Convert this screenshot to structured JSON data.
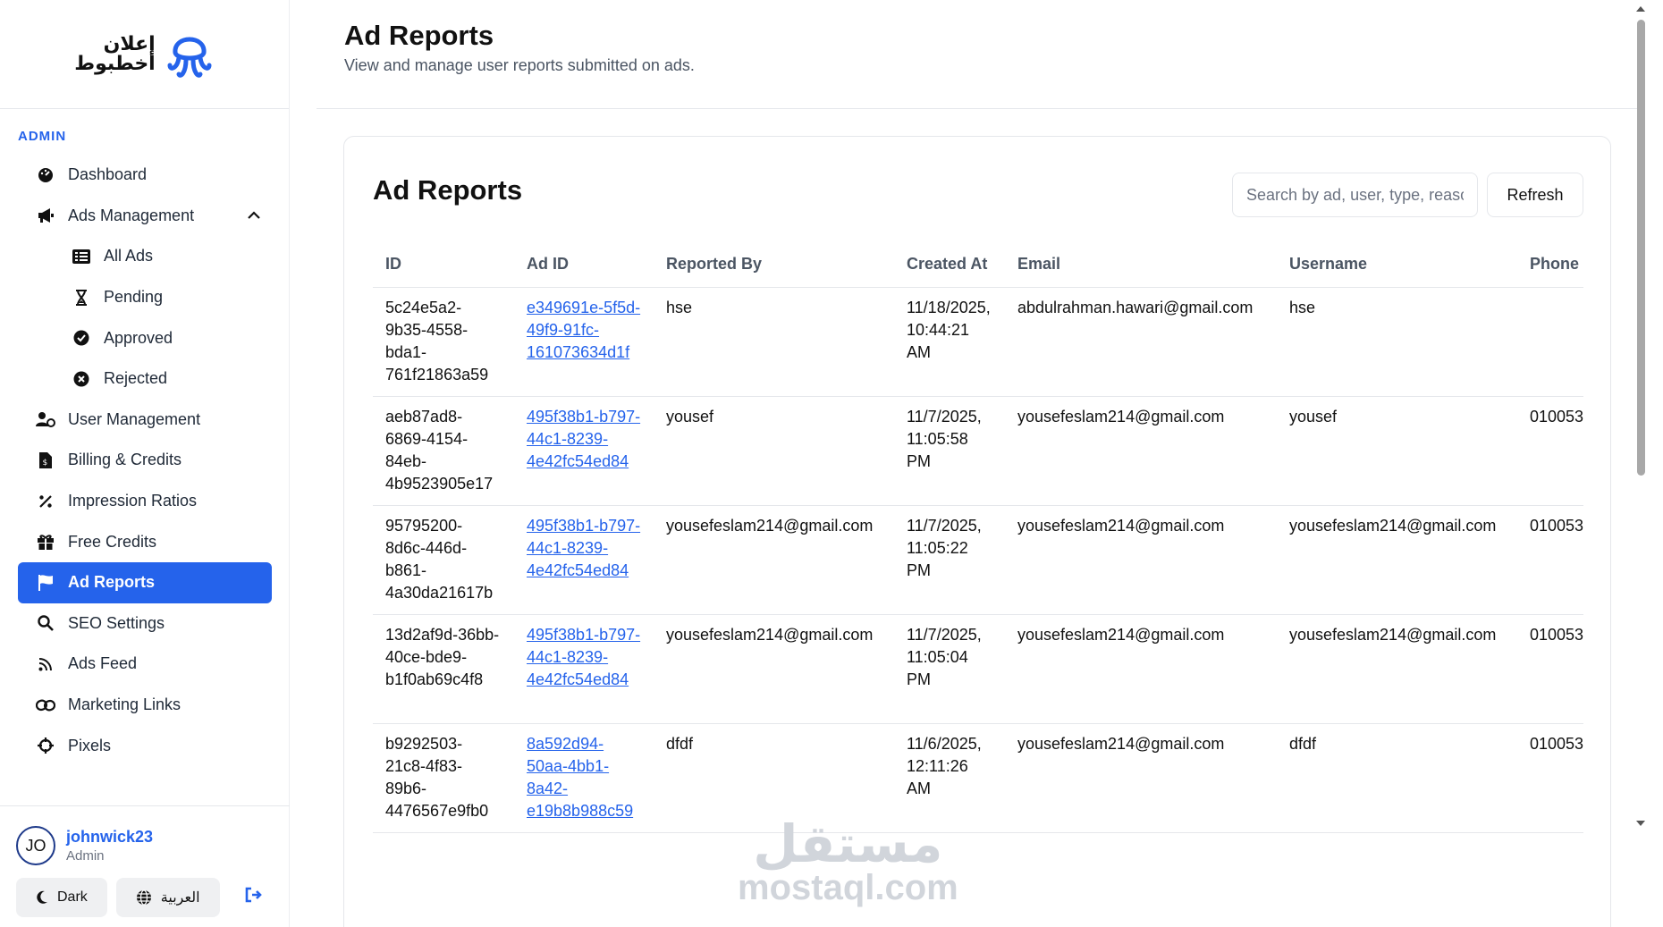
{
  "brand": {
    "logo_text_line1": "إعلان",
    "logo_text_line2": "أخطبوط"
  },
  "sidebar": {
    "section_label": "ADMIN",
    "items": [
      {
        "label": "Dashboard",
        "icon": "dashboard-gauge-icon"
      },
      {
        "label": "Ads Management",
        "icon": "megaphone-icon",
        "expanded": true
      },
      {
        "label": "All Ads",
        "icon": "list-icon",
        "sub": true
      },
      {
        "label": "Pending",
        "icon": "hourglass-icon",
        "sub": true
      },
      {
        "label": "Approved",
        "icon": "check-circle-icon",
        "sub": true
      },
      {
        "label": "Rejected",
        "icon": "x-circle-icon",
        "sub": true
      },
      {
        "label": "User Management",
        "icon": "user-cog-icon"
      },
      {
        "label": "Billing & Credits",
        "icon": "invoice-dollar-icon"
      },
      {
        "label": "Impression Ratios",
        "icon": "percent-icon"
      },
      {
        "label": "Free Credits",
        "icon": "gift-icon"
      },
      {
        "label": "Ad Reports",
        "icon": "flag-icon",
        "active": true
      },
      {
        "label": "SEO Settings",
        "icon": "search-icon"
      },
      {
        "label": "Ads Feed",
        "icon": "rss-icon"
      },
      {
        "label": "Marketing Links",
        "icon": "link-icon"
      },
      {
        "label": "Pixels",
        "icon": "crosshair-icon"
      }
    ]
  },
  "user": {
    "initials": "JO",
    "name": "johnwick23",
    "role": "Admin"
  },
  "footer_buttons": {
    "dark_label": "Dark",
    "lang_label": "العربية"
  },
  "header": {
    "title": "Ad Reports",
    "subtitle": "View and manage user reports submitted on ads."
  },
  "card": {
    "title": "Ad Reports",
    "search_placeholder": "Search by ad, user, type, reason...",
    "refresh_label": "Refresh"
  },
  "table": {
    "columns": [
      "ID",
      "Ad ID",
      "Reported By",
      "Created At",
      "Email",
      "Username",
      "Phone"
    ],
    "rows": [
      {
        "id": "5c24e5a2-9b35-4558-bda1-761f21863a59",
        "ad_id": "e349691e-5f5d-49f9-91fc-161073634d1f",
        "reported_by": "hse",
        "created_at": "11/18/2025, 10:44:21 AM",
        "email": "abdulrahman.hawari@gmail.com",
        "username": "hse",
        "phone": ""
      },
      {
        "id": "aeb87ad8-6869-4154-84eb-4b9523905e17",
        "ad_id": "495f38b1-b797-44c1-8239-4e42fc54ed84",
        "reported_by": "yousef",
        "created_at": "11/7/2025, 11:05:58 PM",
        "email": "yousefeslam214@gmail.com",
        "username": "yousef",
        "phone": "010053"
      },
      {
        "id": "95795200-8d6c-446d-b861-4a30da21617b",
        "ad_id": "495f38b1-b797-44c1-8239-4e42fc54ed84",
        "reported_by": "yousefeslam214@gmail.com",
        "created_at": "11/7/2025, 11:05:22 PM",
        "email": "yousefeslam214@gmail.com",
        "username": "yousefeslam214@gmail.com",
        "phone": "010053"
      },
      {
        "id": "13d2af9d-36bb-40ce-bde9-b1f0ab69c4f8",
        "ad_id": "495f38b1-b797-44c1-8239-4e42fc54ed84",
        "reported_by": "yousefeslam214@gmail.com",
        "created_at": "11/7/2025, 11:05:04 PM",
        "email": "yousefeslam214@gmail.com",
        "username": "yousefeslam214@gmail.com",
        "phone": "010053"
      },
      {
        "id": "b9292503-21c8-4f83-89b6-4476567e9fb0",
        "ad_id": "8a592d94-50aa-4bb1-8a42-e19b8b988c59",
        "reported_by": "dfdf",
        "created_at": "11/6/2025, 12:11:26 AM",
        "email": "yousefeslam214@gmail.com",
        "username": "dfdf",
        "phone": "010053"
      }
    ]
  },
  "watermark": {
    "arabic": "مستقل",
    "latin": "mostaql.com"
  },
  "colors": {
    "accent": "#2563eb",
    "border": "#e5e7eb",
    "muted_text": "#4b5563"
  }
}
